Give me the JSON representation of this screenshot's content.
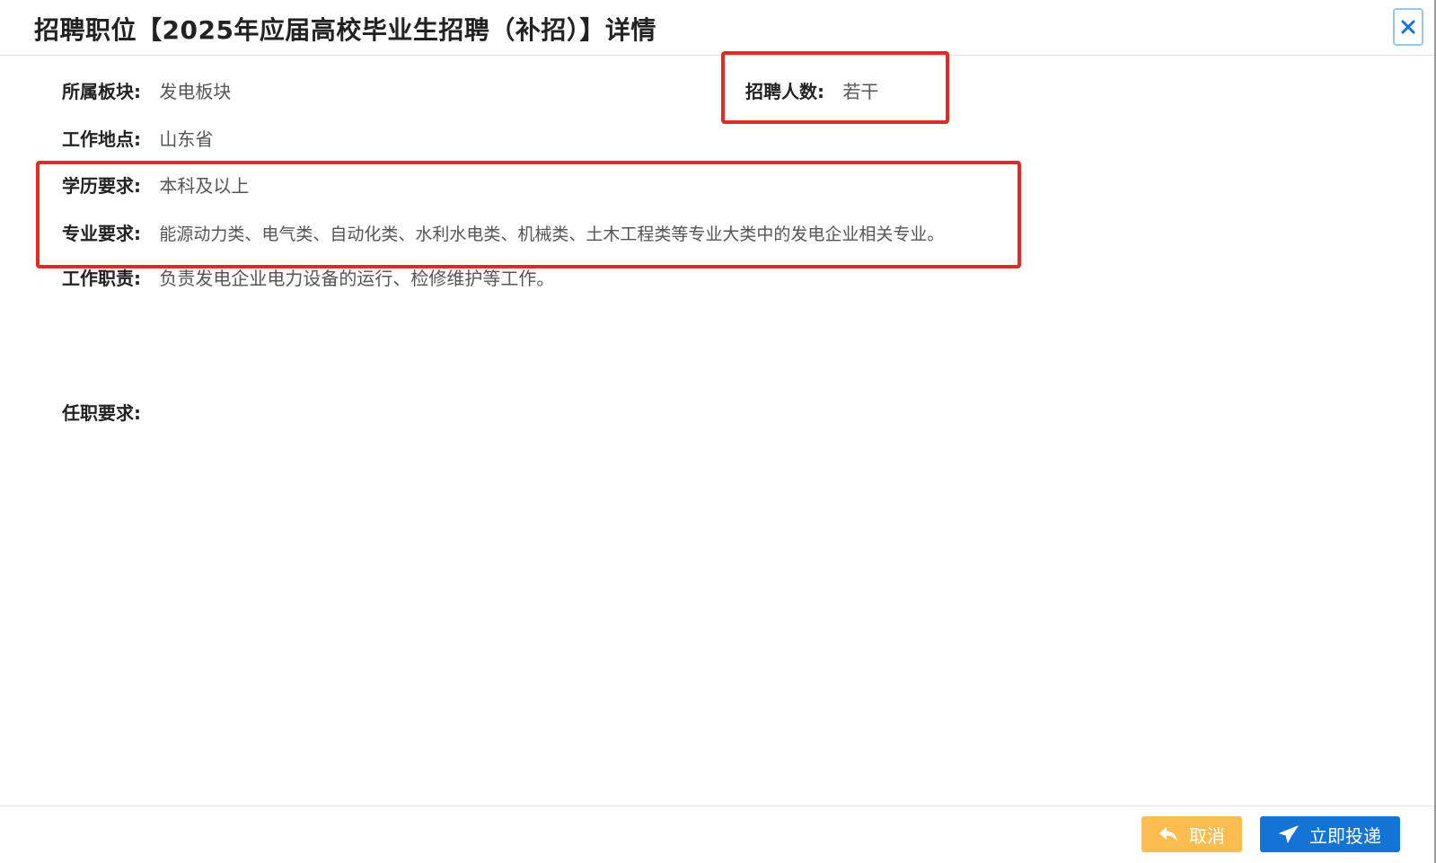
{
  "dialog": {
    "title": "招聘职位【2025年应届高校毕业生招聘（补招）】详情",
    "close_label": "×"
  },
  "fields": {
    "sector": {
      "label": "所属板块:",
      "value": "发电板块"
    },
    "headcount": {
      "label": "招聘人数:",
      "value": "若干"
    },
    "location": {
      "label": "工作地点:",
      "value": "山东省"
    },
    "education": {
      "label": "学历要求:",
      "value": "本科及以上"
    },
    "major": {
      "label": "专业要求:",
      "value": "能源动力类、电气类、自动化类、水利水电类、机械类、土木工程类等专业大类中的发电企业相关专业。"
    },
    "duties": {
      "label": "工作职责:",
      "value": "负责发电企业电力设备的运行、检修维护等工作。"
    },
    "requirements": {
      "label": "任职要求:",
      "value": ""
    }
  },
  "footer": {
    "cancel_label": "取消",
    "submit_label": "立即投递"
  },
  "colors": {
    "highlight": "#e02a22",
    "cancel": "#fbbd4f",
    "submit": "#1474d6",
    "close_icon": "#1474d6"
  },
  "icons": {
    "close": "close-icon",
    "cancel": "reply-arrow-icon",
    "submit": "paper-plane-icon"
  }
}
